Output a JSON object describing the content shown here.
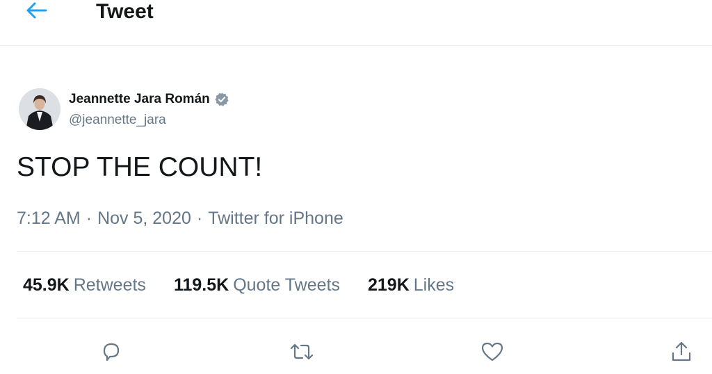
{
  "header": {
    "title": "Tweet",
    "back_icon": "arrow-left-icon",
    "accent_color": "#1da1f2"
  },
  "tweet": {
    "author": {
      "name": "Jeannette Jara Román",
      "handle": "@jeannette_jara",
      "verified": true,
      "verified_icon": "verified-badge-icon"
    },
    "text": "STOP THE COUNT!",
    "time": "7:12 AM",
    "separator": "·",
    "date": "Nov 5, 2020",
    "source": "Twitter for iPhone"
  },
  "stats": {
    "retweets": {
      "count": "45.9K",
      "label": "Retweets"
    },
    "quote_tweets": {
      "count": "119.5K",
      "label": "Quote Tweets"
    },
    "likes": {
      "count": "219K",
      "label": "Likes"
    }
  },
  "actions": [
    {
      "name": "reply",
      "icon": "reply-icon"
    },
    {
      "name": "retweet",
      "icon": "retweet-icon"
    },
    {
      "name": "like",
      "icon": "heart-icon"
    },
    {
      "name": "share",
      "icon": "share-icon"
    }
  ],
  "colors": {
    "text_primary": "#14171a",
    "text_secondary": "#657786",
    "divider": "#e6ecf0",
    "icon": "#657786"
  }
}
